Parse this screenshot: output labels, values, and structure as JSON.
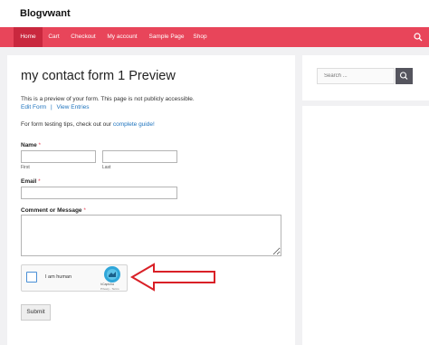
{
  "site": {
    "title": "Blogvwant"
  },
  "nav": {
    "items": [
      {
        "label": "Home"
      },
      {
        "label": "Cart"
      },
      {
        "label": "Checkout"
      },
      {
        "label": "My account"
      },
      {
        "label": "Sample Page"
      },
      {
        "label": "Shop"
      }
    ],
    "active": "Home"
  },
  "page": {
    "title": "my contact form 1 Preview",
    "preview_notice": "This is a preview of your form. This page is not publicly accessible.",
    "edit_link": "Edit Form",
    "separator": "|",
    "entries_link": "View Entries",
    "tips_text": "For form testing tips, check out our",
    "guide_link": "complete guide!"
  },
  "form": {
    "name_label": "Name",
    "required_mark": "*",
    "first_sublabel": "First",
    "last_sublabel": "Last",
    "email_label": "Email",
    "comment_label": "Comment or Message",
    "first_value": "",
    "last_value": "",
    "email_value": "",
    "comment_value": "",
    "submit_label": "Submit"
  },
  "captcha": {
    "label": "I am human",
    "brand": "hCaptcha",
    "terms": "Privacy - Terms",
    "checked": false
  },
  "sidebar": {
    "search_placeholder": "Search ..."
  },
  "colors": {
    "nav_bg": "#e8455a",
    "nav_active": "#c9283e",
    "link": "#1e73be",
    "annotation_arrow": "#d92027",
    "search_button": "#55555e"
  }
}
